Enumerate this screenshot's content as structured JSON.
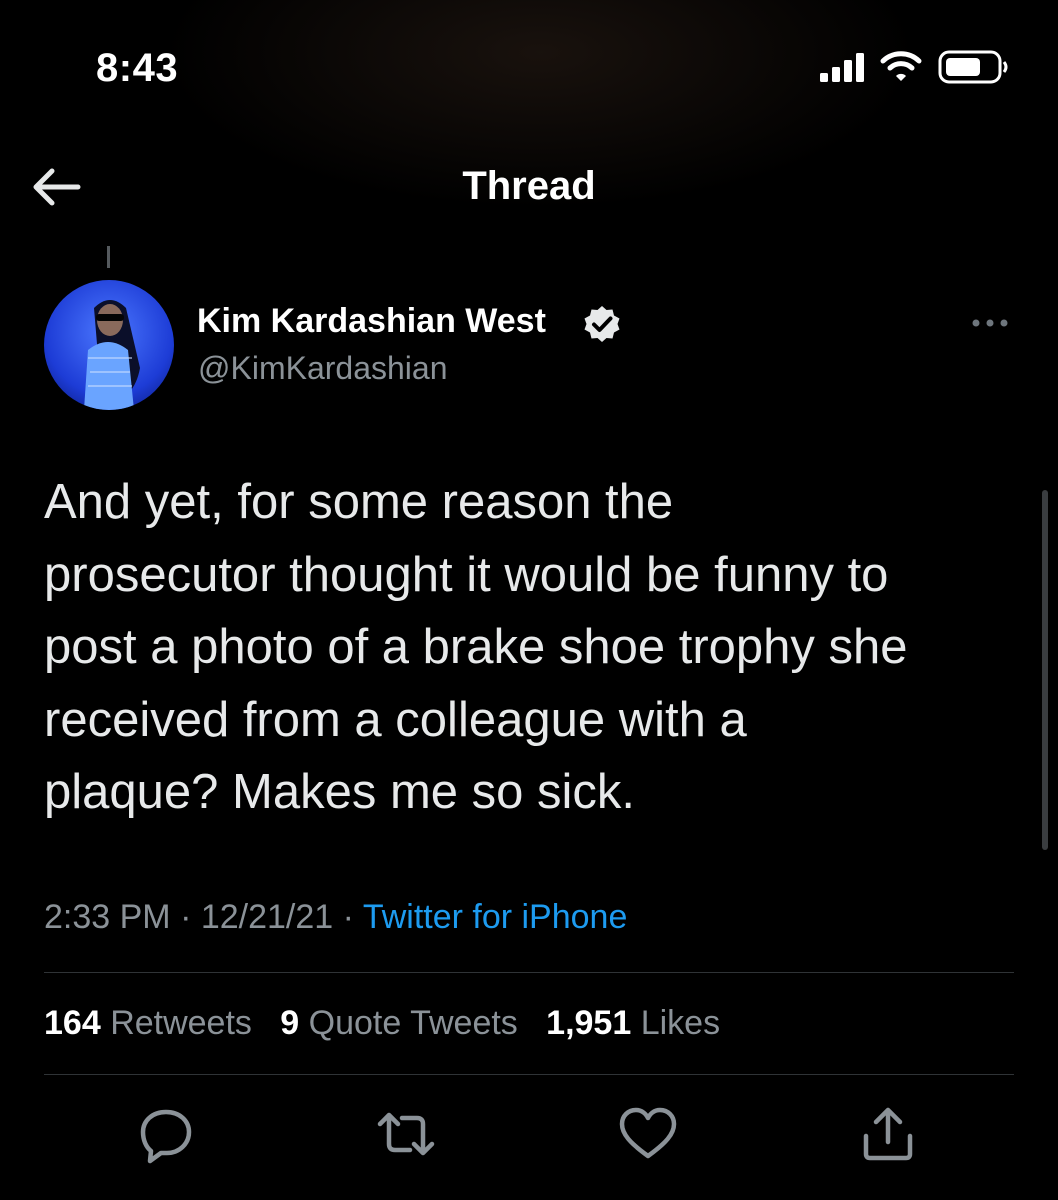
{
  "status_bar": {
    "time": "8:43",
    "icons": [
      "cellular-signal-icon",
      "wifi-icon",
      "battery-icon"
    ]
  },
  "nav": {
    "title": "Thread",
    "back_icon": "back-arrow-icon"
  },
  "tweet": {
    "author": {
      "name": "Kim Kardashian West",
      "handle": "@KimKardashian",
      "verified": true
    },
    "text": "And yet, for some reason the\nprosecutor thought it would be funny to\npost a photo of a brake shoe trophy she\nreceived from a colleague with a\nplaque? Makes me so sick.",
    "time": "2:33 PM",
    "date": "12/21/21",
    "source": "Twitter for iPhone",
    "separator": " · "
  },
  "stats": {
    "retweets_count": "164",
    "retweets_label": "Retweets",
    "quotes_count": "9",
    "quotes_label": "Quote Tweets",
    "likes_count": "1,951",
    "likes_label": "Likes"
  },
  "actions": [
    "reply-icon",
    "retweet-icon",
    "like-icon",
    "share-icon"
  ],
  "colors": {
    "background": "#000000",
    "text": "#e7e9ea",
    "secondary_text": "#8b9298",
    "link": "#1d9bf0",
    "divider": "#2f3336"
  }
}
